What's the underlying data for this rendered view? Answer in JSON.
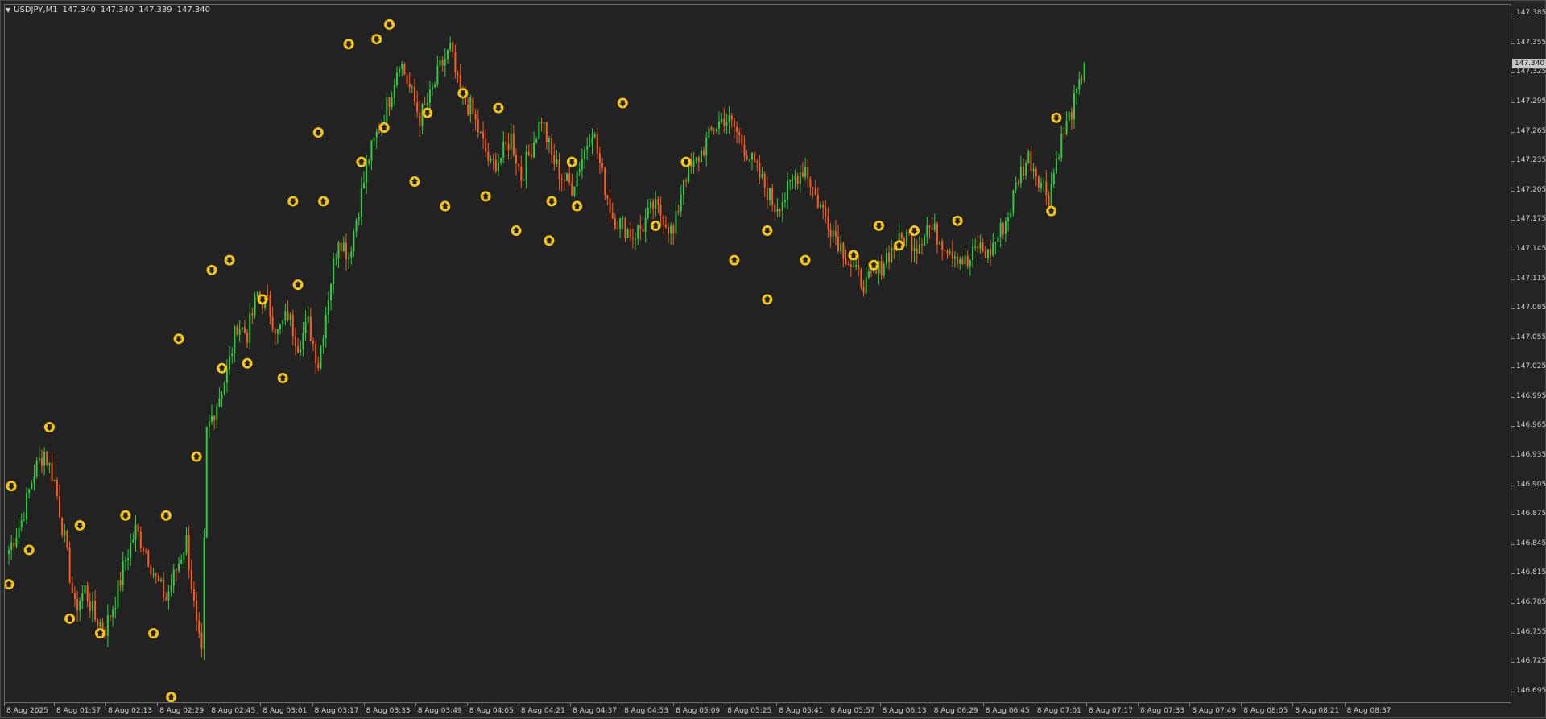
{
  "header": {
    "menu_arrow": "▼",
    "symbol": "USDJPY,M1",
    "open": "147.340",
    "high": "147.340",
    "low": "147.339",
    "close": "147.340"
  },
  "price_axis": {
    "labels": [
      "147.385",
      "147.355",
      "147.325",
      "147.295",
      "147.265",
      "147.235",
      "147.205",
      "147.175",
      "147.145",
      "147.115",
      "147.085",
      "147.055",
      "147.025",
      "146.995",
      "146.965",
      "146.935",
      "146.905",
      "146.875",
      "146.845",
      "146.815",
      "146.785",
      "146.755",
      "146.725",
      "146.695"
    ],
    "current_price_label": "147.340"
  },
  "time_axis": {
    "labels": [
      "8 Aug 2025",
      "8 Aug 01:57",
      "8 Aug 02:13",
      "8 Aug 02:29",
      "8 Aug 02:45",
      "8 Aug 03:01",
      "8 Aug 03:17",
      "8 Aug 03:33",
      "8 Aug 03:49",
      "8 Aug 04:05",
      "8 Aug 04:21",
      "8 Aug 04:37",
      "8 Aug 04:53",
      "8 Aug 05:09",
      "8 Aug 05:25",
      "8 Aug 05:41",
      "8 Aug 05:57",
      "8 Aug 06:13",
      "8 Aug 06:29",
      "8 Aug 06:45",
      "8 Aug 07:01",
      "8 Aug 07:17",
      "8 Aug 07:33",
      "8 Aug 07:49",
      "8 Aug 08:05",
      "8 Aug 08:21",
      "8 Aug 08:37"
    ]
  },
  "colors": {
    "background": "#222222",
    "bull_candle": "#2ecc40",
    "bear_candle": "#ff5a1f",
    "fractal_marker": "#f5c518",
    "axis_text": "#d0d0d0"
  },
  "chart_data": {
    "type": "candlestick",
    "symbol": "USDJPY",
    "timeframe": "M1",
    "ylim": [
      146.685,
      147.395
    ],
    "close_path": [
      [
        0,
        146.84
      ],
      [
        5,
        146.87
      ],
      [
        10,
        146.92
      ],
      [
        14,
        146.94
      ],
      [
        18,
        146.91
      ],
      [
        22,
        146.85
      ],
      [
        26,
        146.78
      ],
      [
        30,
        146.8
      ],
      [
        34,
        146.77
      ],
      [
        38,
        146.76
      ],
      [
        42,
        146.79
      ],
      [
        46,
        146.83
      ],
      [
        50,
        146.86
      ],
      [
        54,
        146.84
      ],
      [
        58,
        146.81
      ],
      [
        62,
        146.79
      ],
      [
        66,
        146.82
      ],
      [
        70,
        146.85
      ],
      [
        74,
        146.76
      ],
      [
        76,
        146.73
      ],
      [
        78,
        146.96
      ],
      [
        82,
        146.99
      ],
      [
        86,
        147.02
      ],
      [
        90,
        147.07
      ],
      [
        94,
        147.06
      ],
      [
        98,
        147.1
      ],
      [
        102,
        147.09
      ],
      [
        106,
        147.06
      ],
      [
        110,
        147.08
      ],
      [
        114,
        147.05
      ],
      [
        118,
        147.07
      ],
      [
        122,
        147.03
      ],
      [
        126,
        147.1
      ],
      [
        130,
        147.16
      ],
      [
        134,
        147.14
      ],
      [
        138,
        147.19
      ],
      [
        142,
        147.24
      ],
      [
        146,
        147.27
      ],
      [
        150,
        147.3
      ],
      [
        154,
        147.34
      ],
      [
        158,
        147.31
      ],
      [
        162,
        147.28
      ],
      [
        166,
        147.3
      ],
      [
        170,
        147.33
      ],
      [
        174,
        147.35
      ],
      [
        178,
        147.3
      ],
      [
        182,
        147.29
      ],
      [
        186,
        147.26
      ],
      [
        190,
        147.23
      ],
      [
        194,
        147.24
      ],
      [
        198,
        147.26
      ],
      [
        202,
        147.22
      ],
      [
        206,
        147.25
      ],
      [
        210,
        147.28
      ],
      [
        214,
        147.24
      ],
      [
        218,
        147.22
      ],
      [
        222,
        147.21
      ],
      [
        226,
        147.24
      ],
      [
        230,
        147.27
      ],
      [
        234,
        147.22
      ],
      [
        238,
        147.18
      ],
      [
        242,
        147.17
      ],
      [
        246,
        147.16
      ],
      [
        250,
        147.17
      ],
      [
        254,
        147.19
      ],
      [
        258,
        147.18
      ],
      [
        262,
        147.16
      ],
      [
        266,
        147.22
      ],
      [
        270,
        147.23
      ],
      [
        274,
        147.25
      ],
      [
        278,
        147.27
      ],
      [
        282,
        147.28
      ],
      [
        286,
        147.27
      ],
      [
        290,
        147.25
      ],
      [
        294,
        147.23
      ],
      [
        298,
        147.21
      ],
      [
        302,
        147.19
      ],
      [
        306,
        147.2
      ],
      [
        310,
        147.22
      ],
      [
        314,
        147.23
      ],
      [
        318,
        147.2
      ],
      [
        322,
        147.18
      ],
      [
        326,
        147.16
      ],
      [
        330,
        147.14
      ],
      [
        334,
        147.12
      ],
      [
        338,
        147.11
      ],
      [
        342,
        147.12
      ],
      [
        346,
        147.14
      ],
      [
        350,
        147.15
      ],
      [
        354,
        147.16
      ],
      [
        358,
        147.15
      ],
      [
        362,
        147.17
      ],
      [
        366,
        147.16
      ],
      [
        370,
        147.15
      ],
      [
        374,
        147.14
      ],
      [
        378,
        147.13
      ],
      [
        382,
        147.15
      ],
      [
        386,
        147.14
      ],
      [
        390,
        147.16
      ],
      [
        394,
        147.18
      ],
      [
        398,
        147.22
      ],
      [
        402,
        147.24
      ],
      [
        406,
        147.22
      ],
      [
        410,
        147.2
      ],
      [
        414,
        147.25
      ],
      [
        418,
        147.28
      ],
      [
        422,
        147.31
      ],
      [
        424,
        147.34
      ]
    ],
    "fractals_up": [
      [
        1,
        146.905
      ],
      [
        16,
        146.965
      ],
      [
        28,
        146.865
      ],
      [
        46,
        146.875
      ],
      [
        62,
        146.875
      ],
      [
        67,
        147.055
      ],
      [
        80,
        147.125
      ],
      [
        87,
        147.135
      ],
      [
        100,
        147.095
      ],
      [
        112,
        147.195
      ],
      [
        122,
        147.265
      ],
      [
        134,
        147.355
      ],
      [
        145,
        147.36
      ],
      [
        150,
        147.375
      ],
      [
        165,
        147.285
      ],
      [
        179,
        147.305
      ],
      [
        193,
        147.29
      ],
      [
        214,
        147.195
      ],
      [
        222,
        147.235
      ],
      [
        242,
        147.295
      ],
      [
        267,
        147.235
      ],
      [
        299,
        147.165
      ],
      [
        343,
        147.17
      ],
      [
        357,
        147.165
      ],
      [
        374,
        147.175
      ],
      [
        413,
        147.28
      ]
    ],
    "fractals_down": [
      [
        0,
        146.805
      ],
      [
        8,
        146.84
      ],
      [
        24,
        146.77
      ],
      [
        36,
        146.755
      ],
      [
        57,
        146.755
      ],
      [
        64,
        146.69
      ],
      [
        74,
        146.935
      ],
      [
        84,
        147.025
      ],
      [
        94,
        147.03
      ],
      [
        108,
        147.015
      ],
      [
        114,
        147.11
      ],
      [
        124,
        147.195
      ],
      [
        139,
        147.235
      ],
      [
        148,
        147.27
      ],
      [
        160,
        147.215
      ],
      [
        172,
        147.19
      ],
      [
        188,
        147.2
      ],
      [
        200,
        147.165
      ],
      [
        213,
        147.155
      ],
      [
        224,
        147.19
      ],
      [
        255,
        147.17
      ],
      [
        286,
        147.135
      ],
      [
        299,
        147.095
      ],
      [
        314,
        147.135
      ],
      [
        333,
        147.14
      ],
      [
        341,
        147.13
      ],
      [
        351,
        147.15
      ],
      [
        411,
        147.185
      ]
    ]
  }
}
